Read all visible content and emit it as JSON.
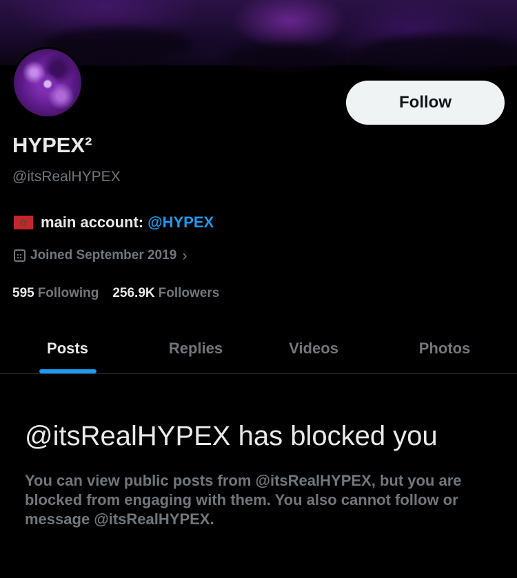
{
  "profile": {
    "name": "HYPEX²",
    "handle": "@itsRealHYPEX",
    "bio_text": "main account:",
    "bio_mention": "@HYPEX",
    "flag_icon": "morocco-flag-icon",
    "joined": "Joined September 2019",
    "following_count": "595",
    "following_label": "Following",
    "followers_count": "256.9K",
    "followers_label": "Followers"
  },
  "actions": {
    "follow_label": "Follow"
  },
  "tabs": [
    {
      "label": "Posts",
      "active": true
    },
    {
      "label": "Replies",
      "active": false
    },
    {
      "label": "Videos",
      "active": false
    },
    {
      "label": "Photos",
      "active": false
    }
  ],
  "blocked": {
    "title": "@itsRealHYPEX has blocked you",
    "description": "You can view public posts from @itsRealHYPEX, but you are blocked from engaging with them. You also cannot follow or message @itsRealHYPEX."
  },
  "colors": {
    "background": "#000000",
    "accent": "#1d9bf0",
    "secondary_text": "#71767b",
    "primary_text": "#e7e9ea"
  }
}
